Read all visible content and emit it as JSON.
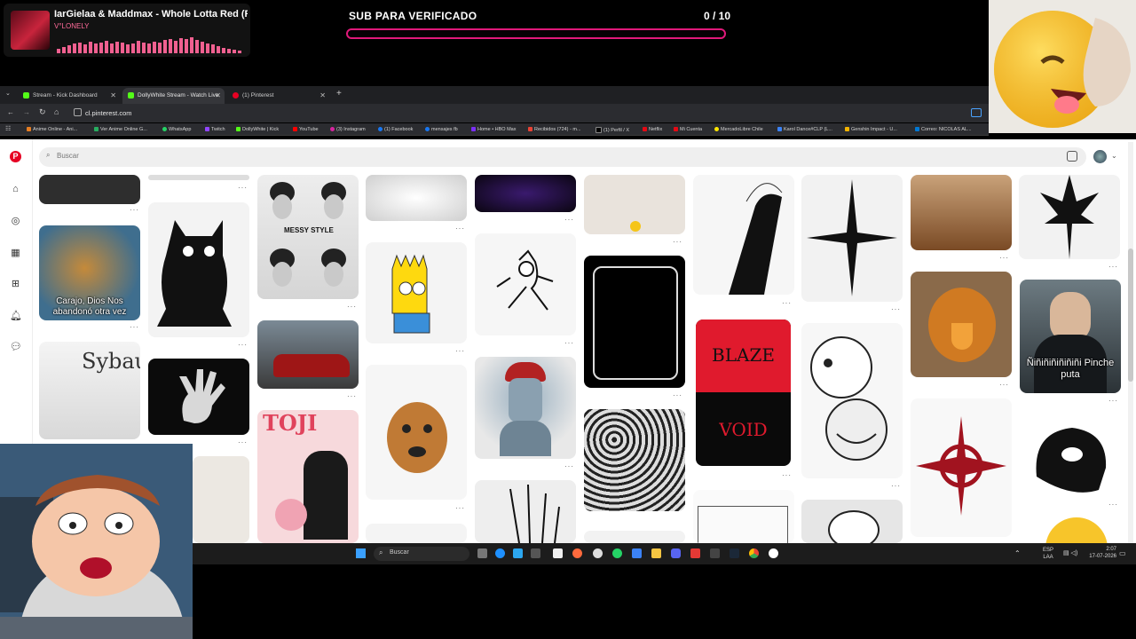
{
  "now_playing": {
    "title": "IarGielaa & Maddmax - Whole Lotta Red (Rema",
    "artist": "V°LONELY"
  },
  "sub_goal": {
    "label": "SUB PARA VERIFICADO",
    "count": "0 / 10",
    "progress": 0
  },
  "tabs": [
    {
      "label": "Stream - Kick Dashboard",
      "active": false
    },
    {
      "label": "DollyWhite Stream - Watch Live",
      "active": true
    },
    {
      "label": "(1) Pinterest",
      "active": false
    }
  ],
  "address": {
    "url": "cl.pinterest.com"
  },
  "bookmarks": [
    "Anime Online - Ani...",
    "Ver Anime Online G...",
    "WhatsApp",
    "Twitch",
    "DollyWhite | Kick",
    "YouTube",
    "(3) Instagram",
    "(1) Facebook",
    "mensajes fb",
    "Home • HBO Max",
    "Recibidos (724) - m...",
    "(1) Perfil / X",
    "Netflix",
    "Mi Cuenta",
    "MercadoLibre Chile",
    "Karol Dance#CLP (L...",
    "Genshin Impact - U...",
    "Correo: NICOLAS AL..."
  ],
  "search": {
    "placeholder": "Buscar"
  },
  "pins": {
    "caption_duck": "Carajo, Dios Nos abandonó otra vez",
    "caption_sybau": "Sybau",
    "caption_messy": "MESSY STYLE",
    "caption_toji": "TOJI",
    "caption_blaze": "BLAZE",
    "caption_void": "VOID",
    "caption_suit": "Ñiñiñiñiñiñiñi Pinche puta"
  },
  "taskbar": {
    "search_placeholder": "Buscar",
    "lang_top": "ESP",
    "lang_bottom": "LAA",
    "time": "2:07",
    "date": "17-07-2026"
  },
  "colors": {
    "accent": "#e0197a",
    "pinterest_red": "#e60023",
    "tab_bg": "#1f2023"
  },
  "icons": [
    "pinterest-logo-icon",
    "home-icon",
    "explore-icon",
    "board-icon",
    "create-icon",
    "notifications-icon",
    "messages-icon",
    "visual-search-icon",
    "windows-start-icon"
  ]
}
